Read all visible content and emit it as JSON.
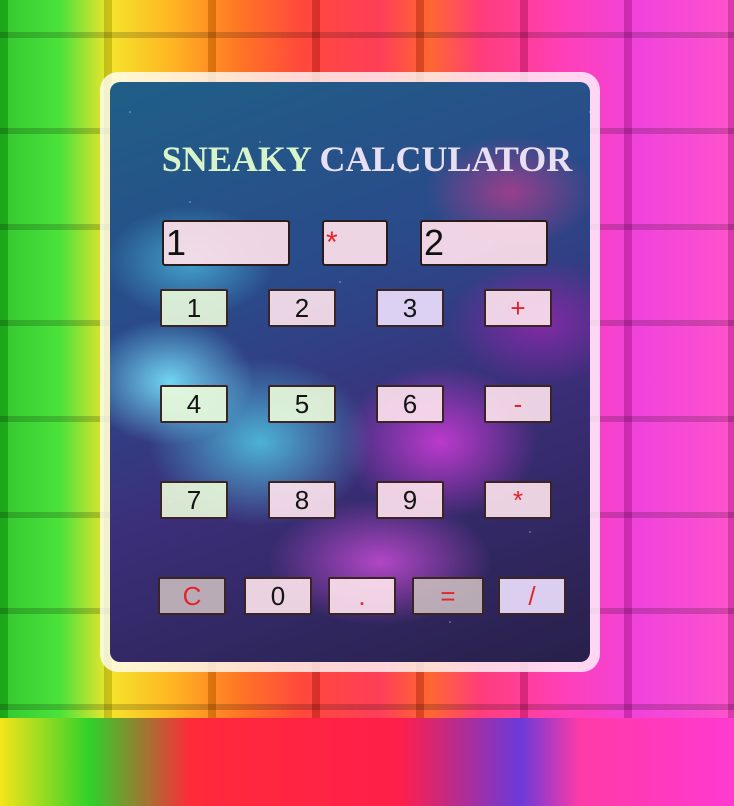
{
  "title": {
    "word1": "SNEAKY",
    "word2": "CALCULATOR"
  },
  "inputs": {
    "left": "1",
    "operator": "*",
    "right": "2"
  },
  "keys": {
    "k1": "1",
    "k2": "2",
    "k3": "3",
    "plus": "+",
    "k4": "4",
    "k5": "5",
    "k6": "6",
    "minus": "-",
    "k7": "7",
    "k8": "8",
    "k9": "9",
    "times": "*",
    "clear": "C",
    "k0": "0",
    "dot": ".",
    "equals": "=",
    "divide": "/"
  },
  "colors": {
    "operator_text": "#e4242a",
    "digit_text": "#141414"
  }
}
